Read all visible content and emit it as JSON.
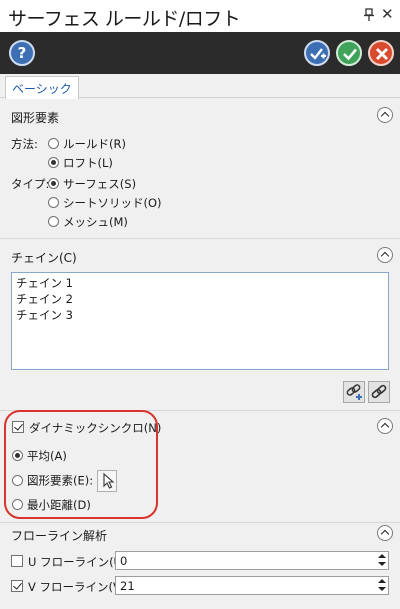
{
  "window": {
    "title": "サーフェス ルールド/ロフト"
  },
  "toolbar": {
    "help_glyph": "?"
  },
  "tabs": [
    {
      "label": "ベーシック"
    }
  ],
  "geometry": {
    "title": "図形要素",
    "method_label": "方法:",
    "method_options": [
      "ルールド(R)",
      "ロフト(L)"
    ],
    "method_selected": "ロフト(L)",
    "type_label": "タイプ:",
    "type_options": [
      "サーフェス(S)",
      "シートソリッド(O)",
      "メッシュ(M)"
    ],
    "type_selected": "サーフェス(S)"
  },
  "chain": {
    "title": "チェイン(C)",
    "items": [
      "チェイン 1",
      "チェイン 2",
      "チェイン 3"
    ]
  },
  "dynamic_sync": {
    "label": "ダイナミックシンクロ(N)",
    "checked": true,
    "options": [
      "平均(A)",
      "図形要素(E):",
      "最小距離(D)"
    ],
    "selected": "平均(A)"
  },
  "flowline": {
    "title": "フローライン解析",
    "u_label": "U フローライン(U):",
    "u_checked": false,
    "u_value": "0",
    "v_label": "V フローライン(V):",
    "v_checked": true,
    "v_value": "21"
  },
  "colors": {
    "accent_blue": "#3d6fb5",
    "ok_green": "#40a35a",
    "cancel_red": "#d94b2f",
    "highlight_red": "#d9332c",
    "toolbar_bg": "#2b2b2b"
  }
}
